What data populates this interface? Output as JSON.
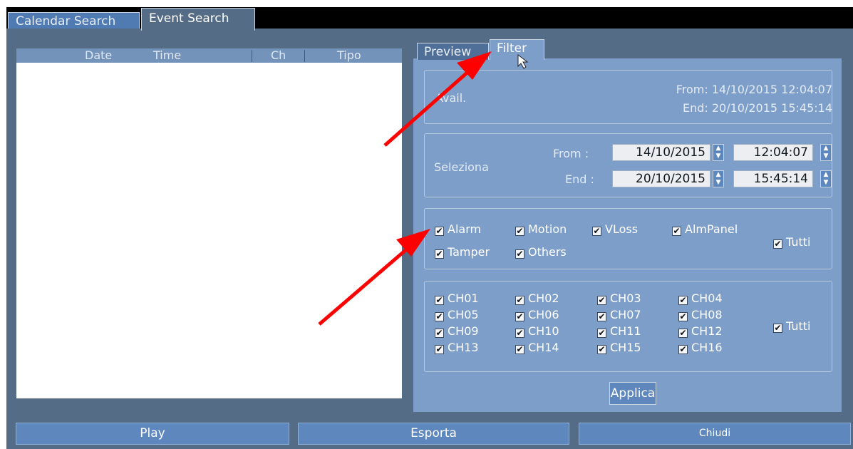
{
  "tabs": {
    "calendar_search": "Calendar Search",
    "event_search": "Event Search"
  },
  "event_list": {
    "columns": [
      "Date",
      "Time",
      "Ch",
      "Tipo"
    ]
  },
  "subtabs": {
    "preview": "Preview",
    "filter": "Filter"
  },
  "avail": {
    "label": "Avail.",
    "from": "From: 14/10/2015 12:04:07",
    "end": "End: 20/10/2015 15:45:14"
  },
  "selection": {
    "label": "Seleziona",
    "from_label": "From :",
    "end_label": "End :",
    "from_date": "14/10/2015",
    "from_time": "12:04:07",
    "end_date": "20/10/2015",
    "end_time": "15:45:14"
  },
  "event_types": {
    "alarm": "Alarm",
    "motion": "Motion",
    "vloss": "VLoss",
    "almpanel": "AlmPanel",
    "tamper": "Tamper",
    "others": "Others",
    "all": "Tutti"
  },
  "channels": {
    "list": [
      "CH01",
      "CH02",
      "CH03",
      "CH04",
      "CH05",
      "CH06",
      "CH07",
      "CH08",
      "CH09",
      "CH10",
      "CH11",
      "CH12",
      "CH13",
      "CH14",
      "CH15",
      "CH16"
    ],
    "all": "Tutti"
  },
  "apply_label": "Applica",
  "bottom": {
    "play": "Play",
    "export": "Esporta",
    "close": "Chiudi"
  },
  "checkmark": "✔",
  "colors": {
    "frame": "#546c86",
    "panel": "#7c9ec9",
    "button": "#5e87bd",
    "arrow": "#ff0000"
  }
}
